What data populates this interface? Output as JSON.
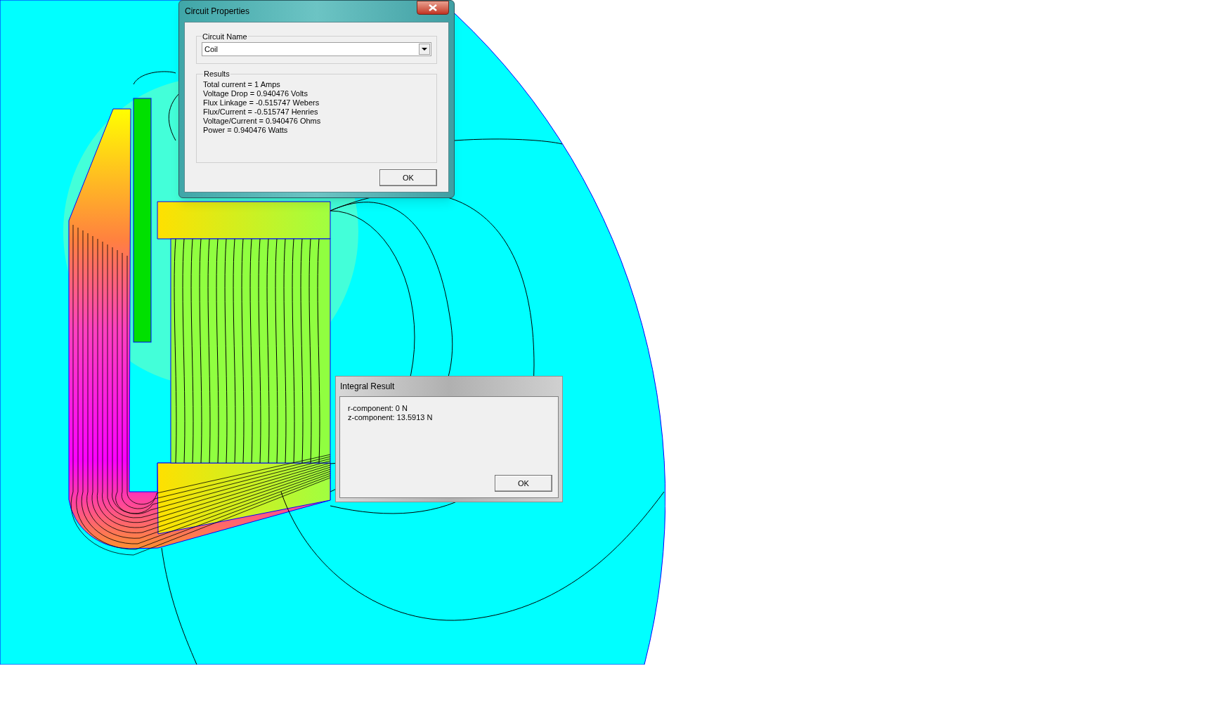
{
  "circuit_properties": {
    "title": "Circuit Properties",
    "circuit_name_label": "Circuit Name",
    "circuit_name": "Coil",
    "results_label": "Results",
    "results": [
      "Total current = 1 Amps",
      "Voltage Drop = 0.940476 Volts",
      "Flux Linkage = -0.515747 Webers",
      "Flux/Current = -0.515747 Henries",
      "Voltage/Current = 0.940476 Ohms",
      "Power = 0.940476 Watts"
    ],
    "ok": "OK"
  },
  "integral_result": {
    "title": "Integral Result",
    "lines": [
      "r-component: 0 N",
      "z-component: 13.5913 N"
    ],
    "ok": "OK"
  }
}
